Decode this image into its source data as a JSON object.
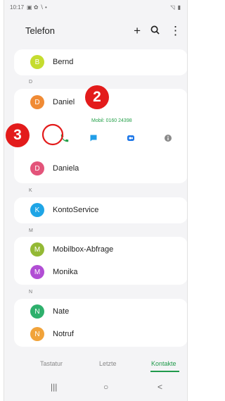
{
  "status_bar": {
    "time": "10:17",
    "left_icons": "▣ ✿ ∖ •",
    "right_icons": "◹ ▮"
  },
  "header": {
    "title": "Telefon",
    "add_icon": "+",
    "search_icon": "⌕",
    "menu_icon": "⋮"
  },
  "contacts": {
    "bernd": {
      "initial": "B",
      "name": "Bernd",
      "color": "#c5dc2f"
    },
    "section_d": "D",
    "daniel": {
      "initial": "D",
      "name": "Daniel",
      "color": "#f08b35",
      "mobile": "Mobil: 0160 24398"
    },
    "daniela": {
      "initial": "D",
      "name": "Daniela",
      "color": "#e3547a"
    },
    "section_k": "K",
    "kontoservice": {
      "initial": "K",
      "name": "KontoService",
      "color": "#1fa5e6"
    },
    "section_m": "M",
    "mobilbox": {
      "initial": "M",
      "name": "Mobilbox-Abfrage",
      "color": "#93b935"
    },
    "monika": {
      "initial": "M",
      "name": "Monika",
      "color": "#b14ed4"
    },
    "section_n": "N",
    "nate": {
      "initial": "N",
      "name": "Nate",
      "color": "#2eb06c"
    },
    "notruf": {
      "initial": "N",
      "name": "Notruf",
      "color": "#f1a33a"
    }
  },
  "annotations": {
    "step_2": "2",
    "step_3": "3"
  },
  "tabs": {
    "keypad": "Tastatur",
    "recents": "Letzte",
    "contacts": "Kontakte"
  },
  "nav": {
    "recents": "|||",
    "home": "○",
    "back": "<"
  },
  "colors": {
    "accent": "#219a4c",
    "annotation": "#e31b1b",
    "call": "#25a04a",
    "message": "#219ee8",
    "video": "#1f78e8",
    "info": "#8a8a8a"
  }
}
